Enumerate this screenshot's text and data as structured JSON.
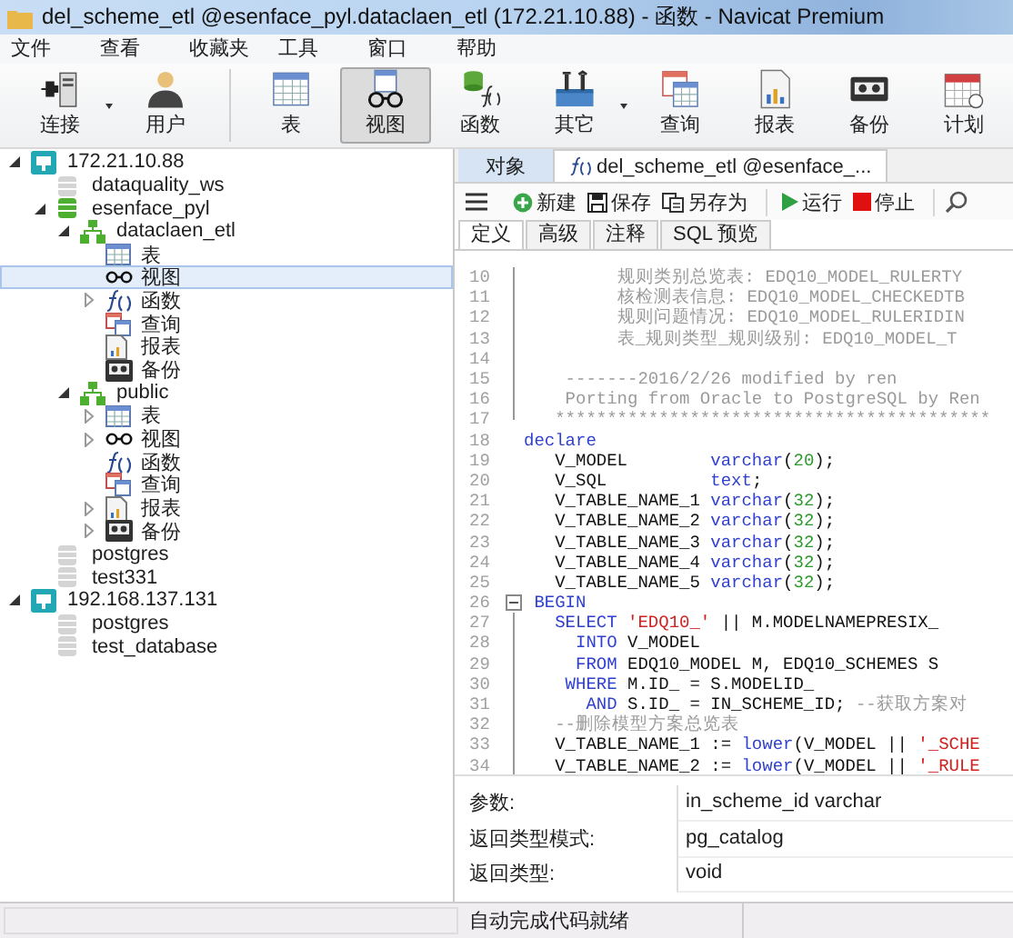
{
  "window": {
    "title": "del_scheme_etl @esenface_pyl.dataclaen_etl (172.21.10.88) - 函数 - Navicat Premium"
  },
  "menu": [
    "文件",
    "查看",
    "收藏夹",
    "工具",
    "窗口",
    "帮助"
  ],
  "toolbar": {
    "groups": [
      [
        {
          "label": "连接",
          "selected": false,
          "dropdown": true
        },
        {
          "label": "用户",
          "selected": false,
          "dropdown": false
        }
      ],
      [
        {
          "label": "表",
          "selected": false,
          "dropdown": false
        },
        {
          "label": "视图",
          "selected": true,
          "dropdown": false
        },
        {
          "label": "函数",
          "selected": false,
          "dropdown": false
        },
        {
          "label": "其它",
          "selected": false,
          "dropdown": true
        },
        {
          "label": "查询",
          "selected": false,
          "dropdown": false
        },
        {
          "label": "报表",
          "selected": false,
          "dropdown": false
        },
        {
          "label": "备份",
          "selected": false,
          "dropdown": false
        },
        {
          "label": "计划",
          "selected": false,
          "dropdown": false
        }
      ]
    ]
  },
  "tree": [
    {
      "label": "172.21.10.88",
      "kind": "connection",
      "expanded": true,
      "selected": false,
      "children": [
        {
          "label": "dataquality_ws",
          "kind": "database",
          "open": false,
          "selected": false
        },
        {
          "label": "esenface_pyl",
          "kind": "database",
          "open": true,
          "expanded": true,
          "selected": false,
          "children": [
            {
              "label": "dataclaen_etl",
              "kind": "schema",
              "expanded": true,
              "selected": false,
              "children": [
                {
                  "label": "表",
                  "kind": "tables",
                  "selected": false
                },
                {
                  "label": "视图",
                  "kind": "views",
                  "selected": true
                },
                {
                  "label": "函数",
                  "kind": "functions",
                  "expanded": false,
                  "selected": false
                },
                {
                  "label": "查询",
                  "kind": "queries",
                  "selected": false
                },
                {
                  "label": "报表",
                  "kind": "reports",
                  "selected": false
                },
                {
                  "label": "备份",
                  "kind": "backups",
                  "selected": false
                }
              ]
            },
            {
              "label": "public",
              "kind": "schema",
              "expanded": true,
              "selected": false,
              "children": [
                {
                  "label": "表",
                  "kind": "tables",
                  "expanded": false,
                  "selected": false
                },
                {
                  "label": "视图",
                  "kind": "views",
                  "expanded": false,
                  "selected": false
                },
                {
                  "label": "函数",
                  "kind": "functions",
                  "selected": false
                },
                {
                  "label": "查询",
                  "kind": "queries",
                  "selected": false
                },
                {
                  "label": "报表",
                  "kind": "reports",
                  "expanded": false,
                  "selected": false
                },
                {
                  "label": "备份",
                  "kind": "backups",
                  "expanded": false,
                  "selected": false
                }
              ]
            }
          ]
        },
        {
          "label": "postgres",
          "kind": "database",
          "open": false,
          "selected": false
        },
        {
          "label": "test331",
          "kind": "database",
          "open": false,
          "selected": false
        }
      ]
    },
    {
      "label": "192.168.137.131",
      "kind": "connection",
      "expanded": true,
      "selected": false,
      "children": [
        {
          "label": "postgres",
          "kind": "database",
          "open": false,
          "selected": false
        },
        {
          "label": "test_database",
          "kind": "database",
          "open": false,
          "selected": false
        }
      ]
    }
  ],
  "tabs": [
    {
      "label": "对象",
      "kind": "objects",
      "selected": false
    },
    {
      "label": "del_scheme_etl @esenface_...",
      "kind": "function",
      "selected": true
    }
  ],
  "editor_toolbar": [
    {
      "label": "新建",
      "kind": "new"
    },
    {
      "label": "保存",
      "kind": "save"
    },
    {
      "label": "另存为",
      "kind": "save_as"
    },
    {
      "label": "运行",
      "kind": "run"
    },
    {
      "label": "停止",
      "kind": "stop"
    }
  ],
  "subtabs": [
    {
      "label": "定义",
      "selected": true
    },
    {
      "label": "高级",
      "selected": false
    },
    {
      "label": "注释",
      "selected": false
    },
    {
      "label": "SQL 预览",
      "selected": false
    }
  ],
  "code": [
    {
      "number": "10",
      "kind": "fold_line",
      "tokens": [
        {
          "kind": "comment",
          "text": "         规则类别总览表: EDQ10_MODEL_RULERTY"
        }
      ]
    },
    {
      "number": "11",
      "kind": "fold_line",
      "tokens": [
        {
          "kind": "comment",
          "text": "         核检测表信息: EDQ10_MODEL_CHECKEDTB"
        }
      ]
    },
    {
      "number": "12",
      "kind": "fold_line",
      "tokens": [
        {
          "kind": "comment",
          "text": "         规则问题情况: EDQ10_MODEL_RULERIDIN"
        }
      ]
    },
    {
      "number": "13",
      "kind": "fold_line",
      "tokens": [
        {
          "kind": "comment",
          "text": "         表_规则类型_规则级别: EDQ10_MODEL_T"
        }
      ]
    },
    {
      "number": "14",
      "kind": "fold_line"
    },
    {
      "number": "15",
      "kind": "fold_line",
      "tokens": [
        {
          "kind": "comment",
          "text": "    -------2016/2/26 modified by ren"
        }
      ]
    },
    {
      "number": "16",
      "kind": "fold_line",
      "tokens": [
        {
          "kind": "comment",
          "text": "    Porting from Oracle to PostgreSQL by Ren"
        }
      ]
    },
    {
      "number": "17",
      "kind": "fold_end",
      "tokens": [
        {
          "kind": "comment",
          "text": "   ******************************************"
        }
      ]
    },
    {
      "number": "18",
      "kind": "plain",
      "tokens": [
        {
          "kind": "keyword",
          "text": "declare"
        }
      ]
    },
    {
      "number": "19",
      "kind": "plain",
      "tokens": [
        {
          "kind": "plain",
          "text": "   V_MODEL        "
        },
        {
          "kind": "keyword",
          "text": "varchar"
        },
        {
          "kind": "plain",
          "text": "("
        },
        {
          "kind": "number",
          "text": "20"
        },
        {
          "kind": "plain",
          "text": ");"
        }
      ]
    },
    {
      "number": "20",
      "kind": "plain",
      "tokens": [
        {
          "kind": "plain",
          "text": "   V_SQL          "
        },
        {
          "kind": "keyword",
          "text": "text"
        },
        {
          "kind": "plain",
          "text": ";"
        }
      ]
    },
    {
      "number": "21",
      "kind": "plain",
      "tokens": [
        {
          "kind": "plain",
          "text": "   V_TABLE_NAME_1 "
        },
        {
          "kind": "keyword",
          "text": "varchar"
        },
        {
          "kind": "plain",
          "text": "("
        },
        {
          "kind": "number",
          "text": "32"
        },
        {
          "kind": "plain",
          "text": ");"
        }
      ]
    },
    {
      "number": "22",
      "kind": "plain",
      "tokens": [
        {
          "kind": "plain",
          "text": "   V_TABLE_NAME_2 "
        },
        {
          "kind": "keyword",
          "text": "varchar"
        },
        {
          "kind": "plain",
          "text": "("
        },
        {
          "kind": "number",
          "text": "32"
        },
        {
          "kind": "plain",
          "text": ");"
        }
      ]
    },
    {
      "number": "23",
      "kind": "plain",
      "tokens": [
        {
          "kind": "plain",
          "text": "   V_TABLE_NAME_3 "
        },
        {
          "kind": "keyword",
          "text": "varchar"
        },
        {
          "kind": "plain",
          "text": "("
        },
        {
          "kind": "number",
          "text": "32"
        },
        {
          "kind": "plain",
          "text": ");"
        }
      ]
    },
    {
      "number": "24",
      "kind": "plain",
      "tokens": [
        {
          "kind": "plain",
          "text": "   V_TABLE_NAME_4 "
        },
        {
          "kind": "keyword",
          "text": "varchar"
        },
        {
          "kind": "plain",
          "text": "("
        },
        {
          "kind": "number",
          "text": "32"
        },
        {
          "kind": "plain",
          "text": ");"
        }
      ]
    },
    {
      "number": "25",
      "kind": "plain",
      "tokens": [
        {
          "kind": "plain",
          "text": "   V_TABLE_NAME_5 "
        },
        {
          "kind": "keyword",
          "text": "varchar"
        },
        {
          "kind": "plain",
          "text": "("
        },
        {
          "kind": "number",
          "text": "32"
        },
        {
          "kind": "plain",
          "text": ");"
        }
      ]
    },
    {
      "number": "26",
      "kind": "fold_start",
      "tokens": [
        {
          "kind": "keyword",
          "text": " BEGIN"
        }
      ]
    },
    {
      "number": "27",
      "kind": "fold_line",
      "tokens": [
        {
          "kind": "keyword",
          "text": "   SELECT"
        },
        {
          "kind": "string",
          "text": " 'EDQ10_'"
        },
        {
          "kind": "plain",
          "text": " || M.MODELNAMEPRESIX_"
        }
      ]
    },
    {
      "number": "28",
      "kind": "fold_line",
      "tokens": [
        {
          "kind": "keyword",
          "text": "     INTO"
        },
        {
          "kind": "plain",
          "text": " V_MODEL"
        }
      ]
    },
    {
      "number": "29",
      "kind": "fold_line",
      "tokens": [
        {
          "kind": "keyword",
          "text": "     FROM"
        },
        {
          "kind": "plain",
          "text": " EDQ10_MODEL M, EDQ10_SCHEMES S"
        }
      ]
    },
    {
      "number": "30",
      "kind": "fold_line",
      "tokens": [
        {
          "kind": "keyword",
          "text": "    WHERE"
        },
        {
          "kind": "plain",
          "text": " M.ID_ = S.MODELID_"
        }
      ]
    },
    {
      "number": "31",
      "kind": "fold_line",
      "tokens": [
        {
          "kind": "keyword",
          "text": "      AND"
        },
        {
          "kind": "plain",
          "text": " S.ID_ = IN_SCHEME_ID; "
        },
        {
          "kind": "comment",
          "text": "--获取方案对"
        }
      ]
    },
    {
      "number": "32",
      "kind": "fold_line",
      "tokens": [
        {
          "kind": "comment",
          "text": "   --删除模型方案总览表"
        }
      ]
    },
    {
      "number": "33",
      "kind": "fold_line",
      "tokens": [
        {
          "kind": "plain",
          "text": "   V_TABLE_NAME_1 := "
        },
        {
          "kind": "keyword",
          "text": "lower"
        },
        {
          "kind": "plain",
          "text": "(V_MODEL || "
        },
        {
          "kind": "string",
          "text": "'_SCHE"
        }
      ]
    },
    {
      "number": "34",
      "kind": "fold_line",
      "tokens": [
        {
          "kind": "plain",
          "text": "   V_TABLE_NAME_2 := "
        },
        {
          "kind": "keyword",
          "text": "lower"
        },
        {
          "kind": "plain",
          "text": "(V_MODEL || "
        },
        {
          "kind": "string",
          "text": "'_RULE"
        }
      ]
    }
  ],
  "properties": [
    {
      "label": "参数:",
      "value": "in_scheme_id varchar"
    },
    {
      "label": "返回类型模式:",
      "value": "pg_catalog"
    },
    {
      "label": "返回类型:",
      "value": "void"
    }
  ],
  "status_bar": {
    "message": "自动完成代码就绪"
  }
}
